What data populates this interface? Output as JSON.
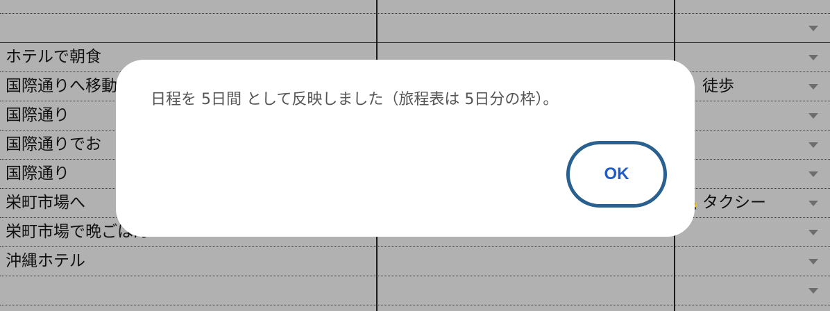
{
  "sheet": {
    "rows": [
      {
        "col1": "",
        "col2": "",
        "col3": "",
        "has_dropdown": false
      },
      {
        "col1": "",
        "col2": "",
        "col3": "",
        "has_dropdown": true
      },
      {
        "col1": "ホテルで朝食",
        "col2": "",
        "col3": "",
        "has_dropdown": true
      },
      {
        "col1": "国際通りへ移動",
        "col2": "",
        "col3": "徒歩",
        "has_dropdown": true
      },
      {
        "col1": "国際通り",
        "col2": "",
        "col3": "",
        "has_dropdown": true
      },
      {
        "col1": "国際通りでお",
        "col2": "",
        "col3": "",
        "has_dropdown": true
      },
      {
        "col1": "国際通り",
        "col2": "",
        "col3": "",
        "has_dropdown": true
      },
      {
        "col1": "栄町市場へ",
        "col2": "",
        "col3": "タクシー",
        "has_dropdown": true
      },
      {
        "col1": "栄町市場で晩ごはん",
        "col2": "",
        "col3": "",
        "has_dropdown": true
      },
      {
        "col1": "沖縄ホテル",
        "col2": "",
        "col3": "",
        "has_dropdown": true
      },
      {
        "col1": "",
        "col2": "",
        "col3": "",
        "has_dropdown": true
      }
    ]
  },
  "dialog": {
    "message": "日程を 5日間 として反映しました（旅程表は 5日分の枠）。",
    "ok_label": "OK"
  },
  "colors": {
    "sheet_background": "#b1b1b1",
    "dialog_background": "#ffffff",
    "message_text": "#555555",
    "ok_text": "#1f5cc8",
    "ok_border": "#29608f"
  },
  "icons": {
    "transport": "taxi-icon"
  }
}
